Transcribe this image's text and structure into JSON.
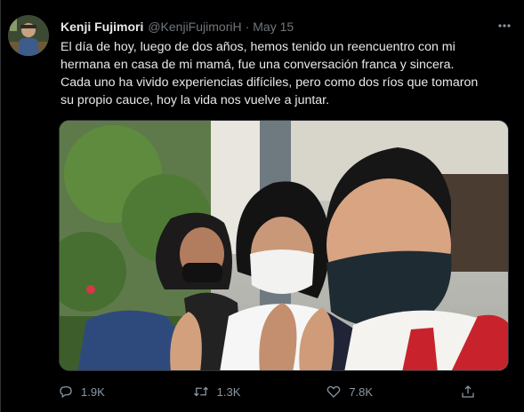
{
  "tweet": {
    "display_name": "Kenji Fujimori",
    "handle": "@KenjiFujimoriH",
    "separator": "·",
    "date": "May 15",
    "text": "El día de hoy, luego de dos años, hemos tenido un reencuentro con mi\nhermana en casa de mi mamá, fue una conversación franca y sincera.\nCada uno ha vivido experiencias difíciles, pero como dos ríos que tomaron\nsu propio cauce, hoy la vida nos vuelve a juntar.",
    "media_icon": "photo",
    "actions": {
      "reply_count": "1.9K",
      "retweet_count": "1.3K",
      "like_count": "7.8K"
    },
    "icons": {
      "reply": "reply-icon",
      "retweet": "retweet-icon",
      "like": "heart-icon",
      "share": "share-icon",
      "more": "more-icon"
    },
    "colors": {
      "background": "#000000",
      "secondary_text": "#71767b",
      "primary_text": "#e7e9ea"
    }
  }
}
